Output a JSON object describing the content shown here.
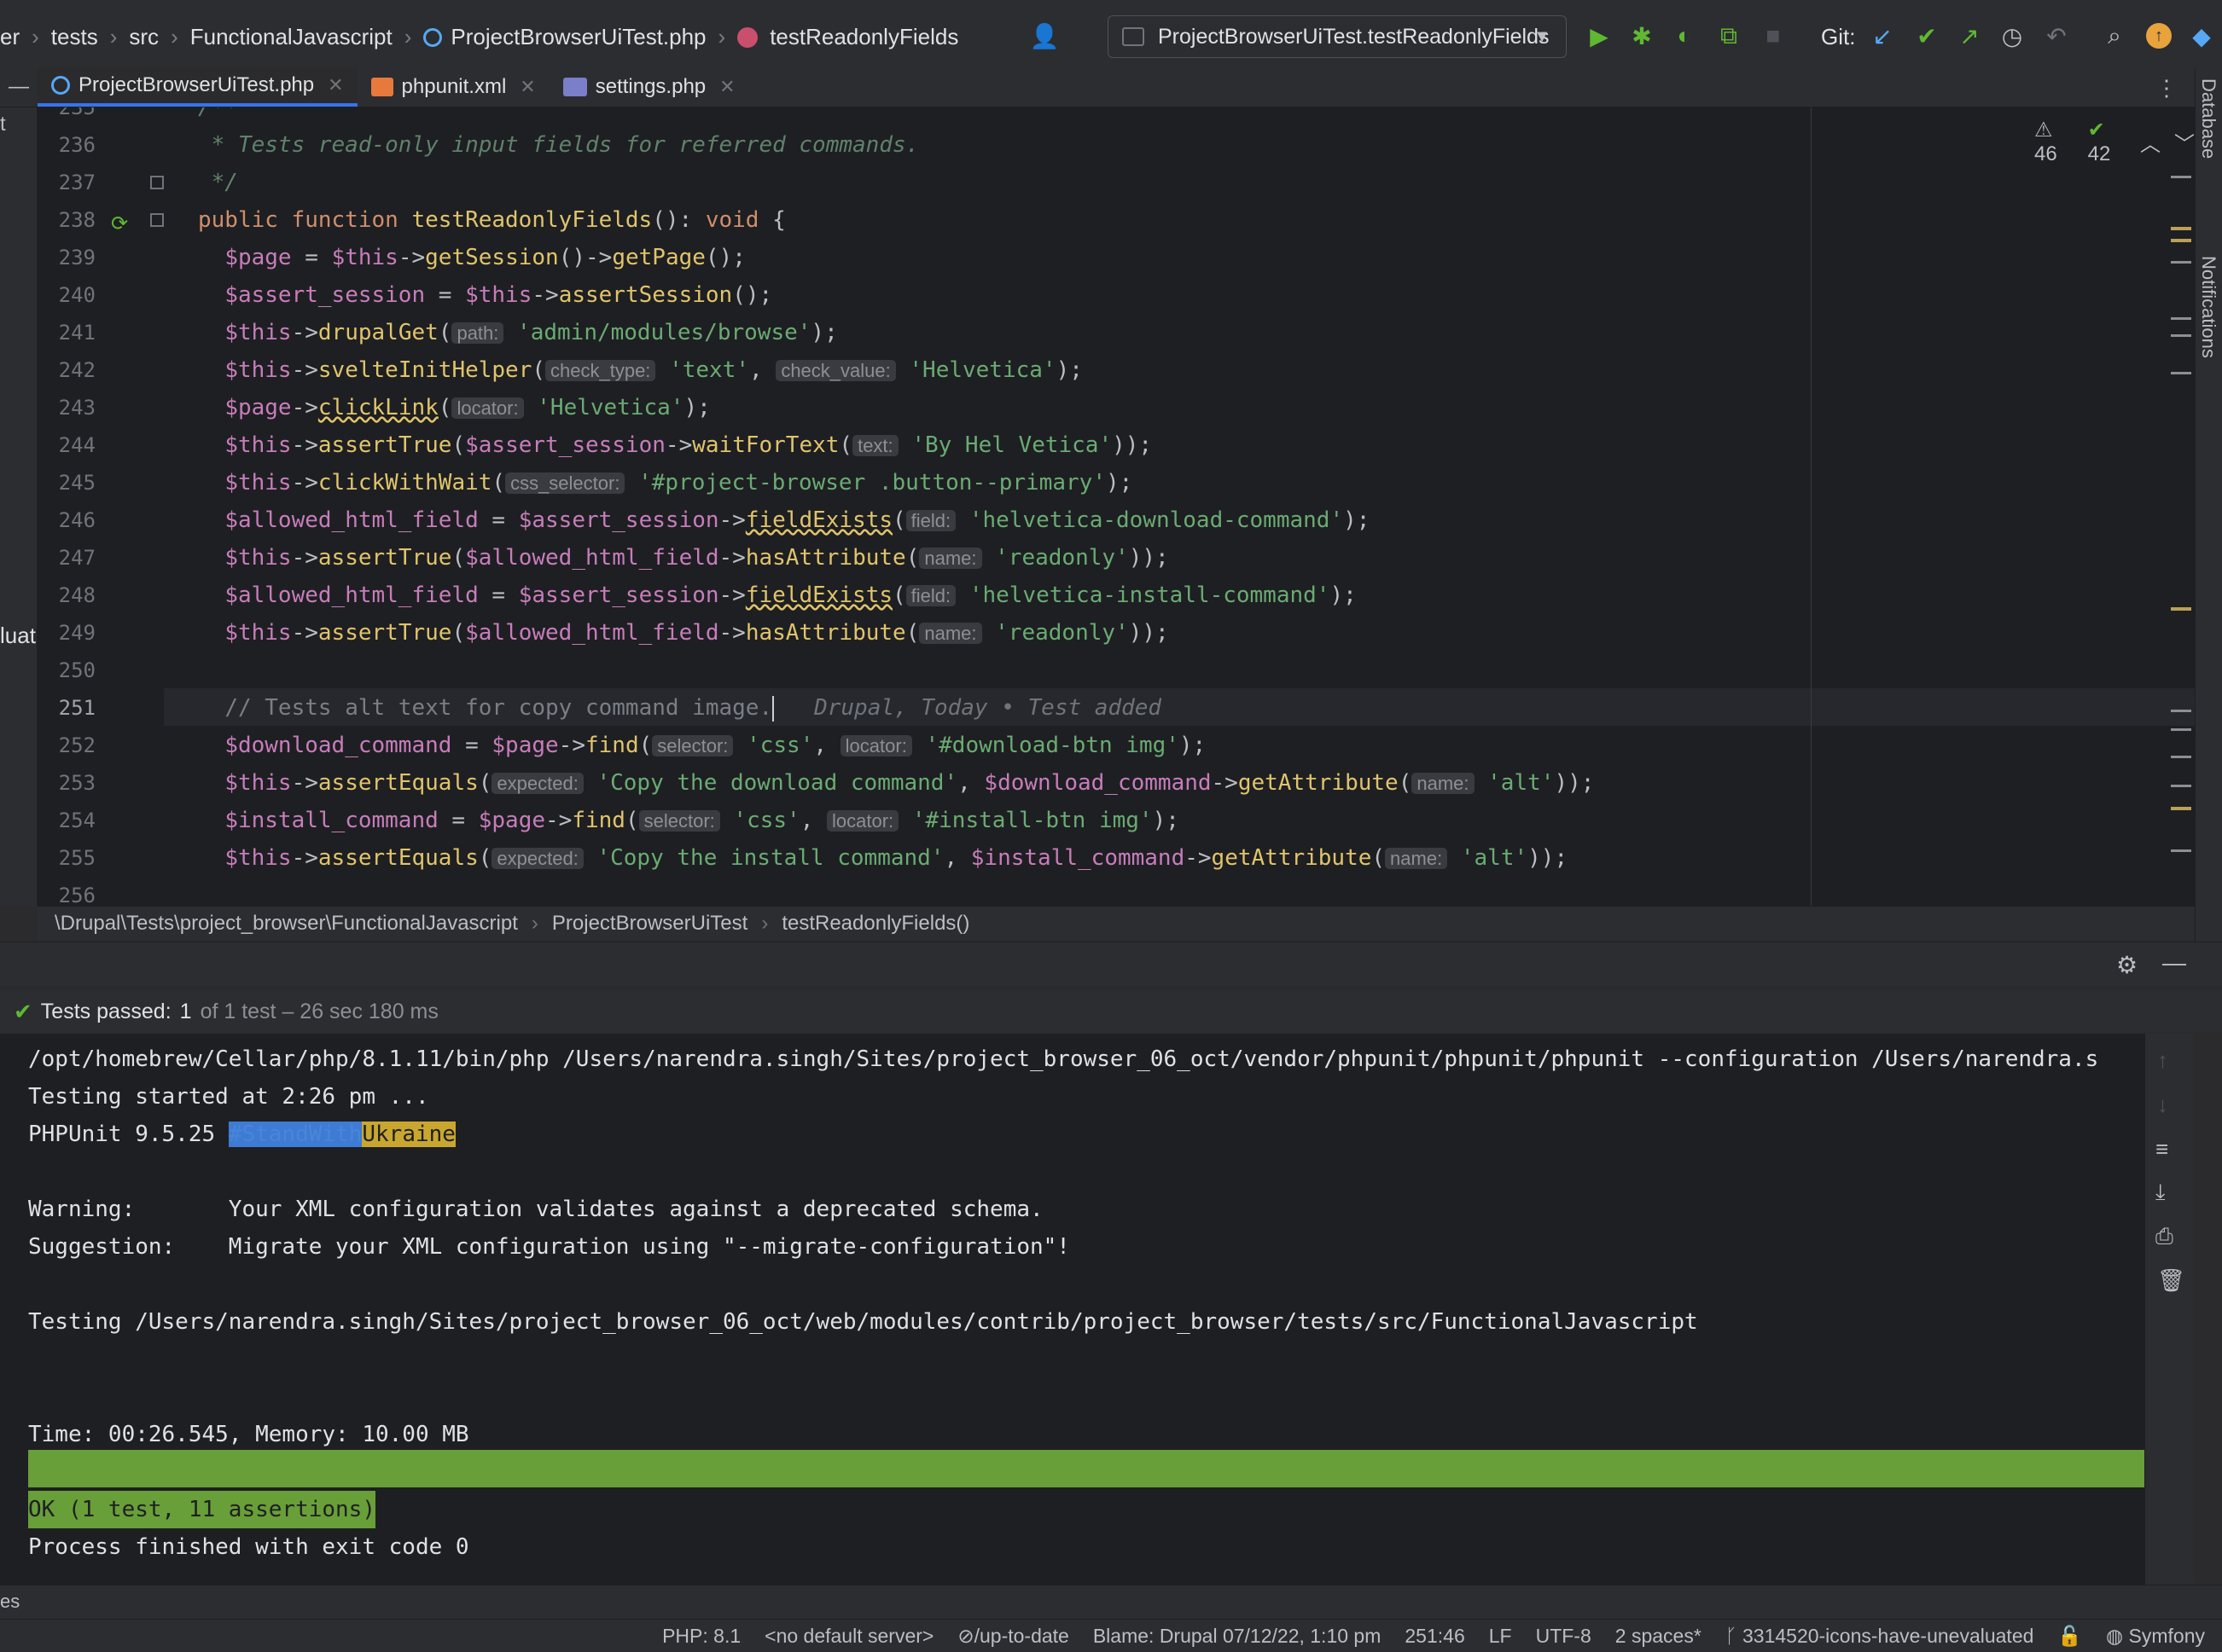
{
  "topbar": {
    "breadcrumb": [
      "er",
      "tests",
      "src",
      "FunctionalJavascript",
      "ProjectBrowserUiTest.php",
      "testReadonlyFields"
    ],
    "run_config": "ProjectBrowserUiTest.testReadonlyFields",
    "git_label": "Git:"
  },
  "tabs": [
    {
      "label": "ProjectBrowserUiTest.php",
      "active": true
    },
    {
      "label": "phpunit.xml",
      "active": false
    },
    {
      "label": "settings.php",
      "active": false
    }
  ],
  "inspections": {
    "warnings": "46",
    "ok": "42"
  },
  "editor": {
    "line_numbers": [
      "235",
      "236",
      "237",
      "238",
      "239",
      "240",
      "241",
      "242",
      "243",
      "244",
      "245",
      "246",
      "247",
      "248",
      "249",
      "250",
      "251",
      "252",
      "253",
      "254",
      "255",
      "256"
    ],
    "current_line": "251",
    "l235": "/**",
    "l236": " * Tests read-only input fields for referred commands.",
    "l237": " */",
    "l238": {
      "kw1": "public function ",
      "name": "testReadonlyFields",
      "rest": "(): ",
      "type": "void",
      "brace": " {"
    },
    "l239": {
      "v1": "$page",
      "eq": " = ",
      "v2": "$this",
      "a": "->",
      "m1": "getSession",
      "b": "()->",
      "m2": "getPage",
      "c": "();"
    },
    "l240": {
      "v1": "$assert_session",
      "eq": " = ",
      "v2": "$this",
      "a": "->",
      "m1": "assertSession",
      "c": "();"
    },
    "l241": {
      "v": "$this",
      "a": "->",
      "m": "drupalGet",
      "p": "(",
      "hint": "path:",
      "s": "'admin/modules/browse'",
      "c": ");"
    },
    "l242": {
      "v": "$this",
      "a": "->",
      "m": "svelteInitHelper",
      "p": "(",
      "hint1": "check_type:",
      "s1": "'text'",
      "comma": ", ",
      "hint2": "check_value:",
      "s2": "'Helvetica'",
      "c": ");"
    },
    "l243": {
      "v": "$page",
      "a": "->",
      "m": "clickLink",
      "p": "(",
      "hint": "locator:",
      "s": "'Helvetica'",
      "c": ");"
    },
    "l244": {
      "v": "$this",
      "a": "->",
      "m": "assertTrue",
      "p": "(",
      "v2": "$assert_session",
      "a2": "->",
      "m2": "waitForText",
      "p2": "(",
      "hint": "text:",
      "s": "'By Hel Vetica'",
      "c": "));"
    },
    "l245": {
      "v": "$this",
      "a": "->",
      "m": "clickWithWait",
      "p": "(",
      "hint": "css_selector:",
      "s": "'#project-browser .button--primary'",
      "c": ");"
    },
    "l246": {
      "v": "$allowed_html_field",
      "eq": " = ",
      "v2": "$assert_session",
      "a": "->",
      "m": "fieldExists",
      "p": "(",
      "hint": "field:",
      "s": "'helvetica-download-command'",
      "c": ");"
    },
    "l247": {
      "v": "$this",
      "a": "->",
      "m": "assertTrue",
      "p": "(",
      "v2": "$allowed_html_field",
      "a2": "->",
      "m2": "hasAttribute",
      "p2": "(",
      "hint": "name:",
      "s": "'readonly'",
      "c": "));"
    },
    "l248": {
      "v": "$allowed_html_field",
      "eq": " = ",
      "v2": "$assert_session",
      "a": "->",
      "m": "fieldExists",
      "p": "(",
      "hint": "field:",
      "s": "'helvetica-install-command'",
      "c": ");"
    },
    "l249": {
      "v": "$this",
      "a": "->",
      "m": "assertTrue",
      "p": "(",
      "v2": "$allowed_html_field",
      "a2": "->",
      "m2": "hasAttribute",
      "p2": "(",
      "hint": "name:",
      "s": "'readonly'",
      "c": "));"
    },
    "l251": {
      "comment": "// Tests alt text for copy command image.",
      "blame": "Drupal, Today • Test added"
    },
    "l252": {
      "v": "$download_command",
      "eq": " = ",
      "v2": "$page",
      "a": "->",
      "m": "find",
      "p": "(",
      "hint1": "selector:",
      "s1": "'css'",
      "comma": ", ",
      "hint2": "locator:",
      "s2": "'#download-btn img'",
      "c": ");"
    },
    "l253": {
      "v": "$this",
      "a": "->",
      "m": "assertEquals",
      "p": "(",
      "hint1": "expected:",
      "s1": "'Copy the download command'",
      "comma": ", ",
      "v2": "$download_command",
      "a2": "->",
      "m2": "getAttribute",
      "p2": "(",
      "hint2": "name:",
      "s2": "'alt'",
      "c": "));"
    },
    "l254": {
      "v": "$install_command",
      "eq": " = ",
      "v2": "$page",
      "a": "->",
      "m": "find",
      "p": "(",
      "hint1": "selector:",
      "s1": "'css'",
      "comma": ", ",
      "hint2": "locator:",
      "s2": "'#install-btn img'",
      "c": ");"
    },
    "l255": {
      "v": "$this",
      "a": "->",
      "m": "assertEquals",
      "p": "(",
      "hint1": "expected:",
      "s1": "'Copy the install command'",
      "comma": ", ",
      "v2": "$install_command",
      "a2": "->",
      "m2": "getAttribute",
      "p2": "(",
      "hint2": "name:",
      "s2": "'alt'",
      "c": "));"
    }
  },
  "editor_breadcrumb": [
    "\\Drupal\\Tests\\project_browser\\FunctionalJavascript",
    "ProjectBrowserUiTest",
    "testReadonlyFields()"
  ],
  "test_status": {
    "label": "Tests passed:",
    "count": "1",
    "detail": "of 1 test – 26 sec 180 ms"
  },
  "console": {
    "l1": "/opt/homebrew/Cellar/php/8.1.11/bin/php /Users/narendra.singh/Sites/project_browser_06_oct/vendor/phpunit/phpunit/phpunit --configuration /Users/narendra.s",
    "l2": "Testing started at 2:26 pm ...",
    "l3a": "PHPUnit 9.5.25 ",
    "l3b": "#StandWith",
    "l3c": "Ukraine",
    "l5": "Warning:       Your XML configuration validates against a deprecated schema.",
    "l6": "Suggestion:    Migrate your XML configuration using \"--migrate-configuration\"!",
    "l8": "Testing /Users/narendra.singh/Sites/project_browser_06_oct/web/modules/contrib/project_browser/tests/src/FunctionalJavascript",
    "l11": "Time: 00:26.545, Memory: 10.00 MB",
    "l13": "OK (1 test, 11 assertions)",
    "l14": "Process finished with exit code 0"
  },
  "left_clips": {
    "t": "t",
    "luat": "luat",
    "es": "es"
  },
  "right_strip": {
    "database": "Database",
    "notifications": "Notifications"
  },
  "statusbar": {
    "php": "PHP: 8.1",
    "server": "<no default server>",
    "vcs": "⊘/up-to-date",
    "blame": "Blame: Drupal 07/12/22, 1:10 pm",
    "position": "251:46",
    "line_sep": "LF",
    "encoding": "UTF-8",
    "indent": "2 spaces*",
    "branch": "3314520-icons-have-unevaluated",
    "framework": "Symfony"
  },
  "colors": {
    "accent": "#3574f0",
    "ok_bar": "#689f38",
    "run_green": "#5fb832"
  }
}
